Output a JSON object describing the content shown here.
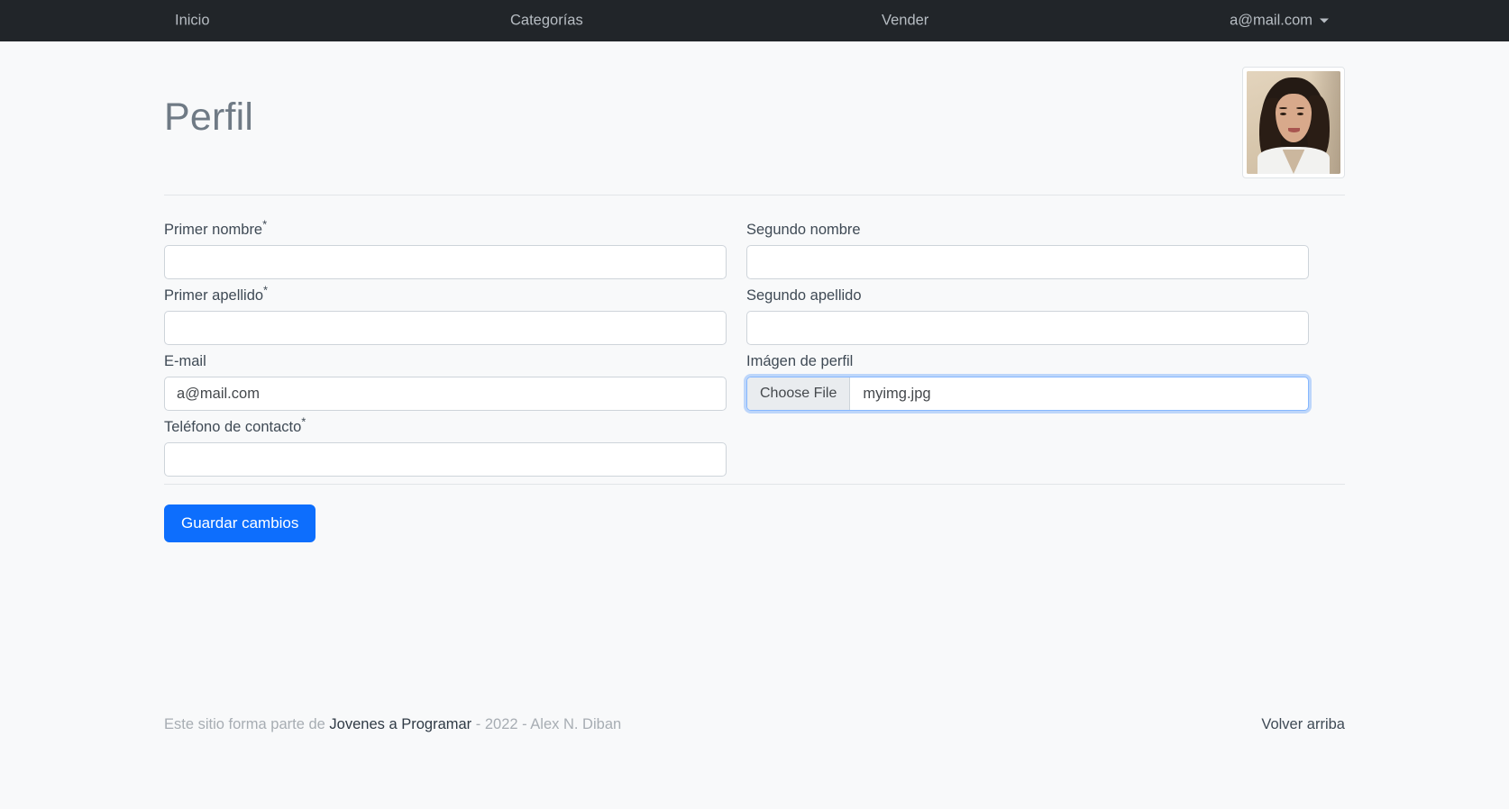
{
  "navbar": {
    "items": [
      {
        "label": "Inicio",
        "name": "nav-inicio"
      },
      {
        "label": "Categorías",
        "name": "nav-categorias"
      },
      {
        "label": "Vender",
        "name": "nav-vender"
      }
    ],
    "user": {
      "label": "a@mail.com",
      "caret_icon": "chevron-down-icon"
    },
    "background_color": "#212529",
    "text_color": "#b6bcc2"
  },
  "page": {
    "title": "Perfil",
    "avatar_alt": "Imágen de perfil"
  },
  "form": {
    "fields": {
      "primer_nombre": {
        "label": "Primer nombre",
        "required_mark": "*",
        "value": "",
        "placeholder": ""
      },
      "segundo_nombre": {
        "label": "Segundo nombre",
        "required_mark": "",
        "value": "",
        "placeholder": ""
      },
      "primer_apellido": {
        "label": "Primer apellido",
        "required_mark": "*",
        "value": "",
        "placeholder": ""
      },
      "segundo_apellido": {
        "label": "Segundo apellido",
        "required_mark": "",
        "value": "",
        "placeholder": ""
      },
      "email": {
        "label": "E-mail",
        "required_mark": "",
        "value": "a@mail.com",
        "placeholder": ""
      },
      "imagen_perfil": {
        "label": "Imágen de perfil",
        "required_mark": "",
        "button_label": "Choose File",
        "file_name": "myimg.jpg"
      },
      "telefono": {
        "label": "Teléfono de contacto",
        "required_mark": "*",
        "value": "",
        "placeholder": ""
      }
    },
    "submit_label": "Guardar cambios",
    "submit_color": "#0d6efd"
  },
  "footer": {
    "prefix": "Este sitio forma parte de ",
    "site_name": "Jovenes a Programar",
    "suffix": " - 2022 - Alex N. Diban",
    "back_to_top": "Volver arriba"
  }
}
